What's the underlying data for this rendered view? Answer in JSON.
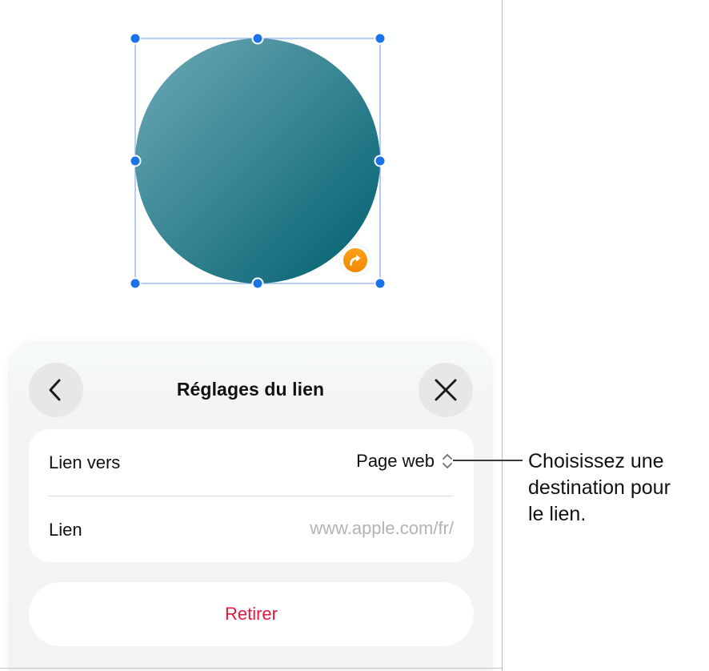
{
  "shape": {
    "gradient_start": "#6aa6b3",
    "gradient_end": "#006978",
    "selection_color": "#1a73e8",
    "link_badge_color": "#f5930e",
    "link_badge_icon": "curved-arrow-icon"
  },
  "link_sheet": {
    "title": "Réglages du lien",
    "back_icon": "chevron-left-icon",
    "close_icon": "close-icon",
    "link_to_label": "Lien vers",
    "link_to_value": "Page web",
    "link_to_icon": "up-down-chevron-icon",
    "link_label": "Lien",
    "link_placeholder": "www.apple.com/fr/",
    "remove_label": "Retirer",
    "remove_color": "#e0183c"
  },
  "callout": {
    "line1": "Choisissez une",
    "line2": "destination pour",
    "line3": "le lien."
  }
}
